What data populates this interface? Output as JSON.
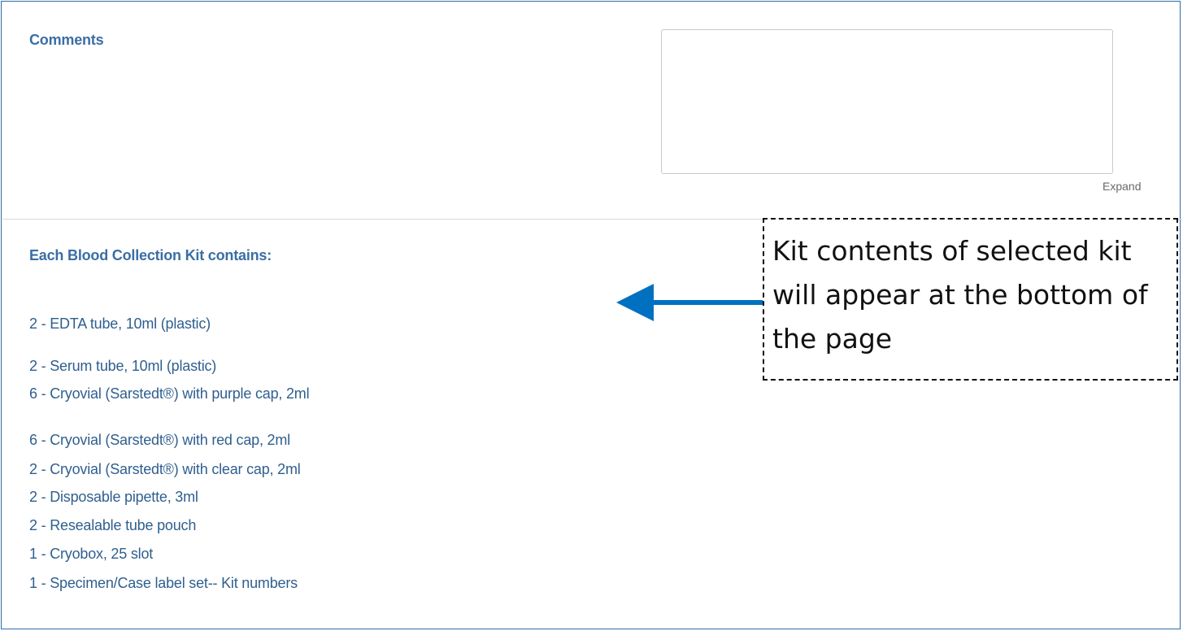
{
  "comments": {
    "label": "Comments",
    "value": "",
    "expand_label": "Expand"
  },
  "kit": {
    "heading": "Each Blood Collection Kit contains:",
    "items": [
      "2 - EDTA tube, 10ml (plastic)",
      "2 - Serum tube, 10ml (plastic)",
      "6 - Cryovial (Sarstedt®) with purple cap, 2ml",
      "6 - Cryovial (Sarstedt®) with red cap, 2ml",
      "2 - Cryovial (Sarstedt®) with clear cap, 2ml",
      "2 - Disposable pipette, 3ml",
      "2 - Resealable tube pouch",
      "1 - Cryobox, 25 slot",
      "1 - Specimen/Case label set-- Kit numbers"
    ]
  },
  "callout": {
    "text": "Kit contents of selected kit will appear at the bottom of the page",
    "arrow_color": "#0070c0"
  },
  "colors": {
    "frame_border": "#2d6da6",
    "label_blue": "#3a6ea5",
    "item_blue": "#2f5f8f"
  }
}
